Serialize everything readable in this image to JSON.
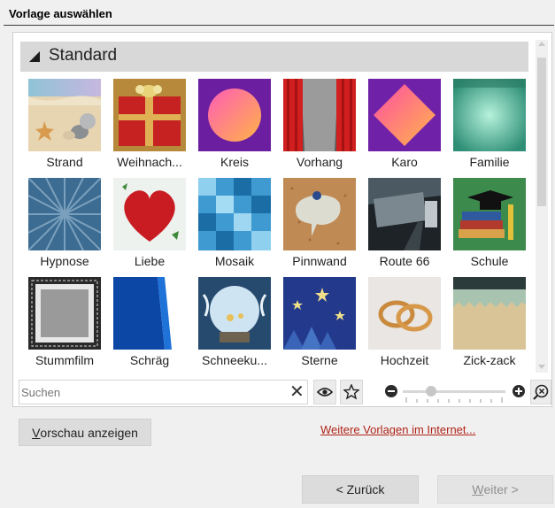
{
  "window": {
    "title": "Vorlage auswählen"
  },
  "group": {
    "title": "Standard"
  },
  "templates": [
    {
      "label": "Strand",
      "icon": "beach-thumbnail"
    },
    {
      "label": "Weihnach...",
      "icon": "gift-thumbnail"
    },
    {
      "label": "Kreis",
      "icon": "circle-thumbnail"
    },
    {
      "label": "Vorhang",
      "icon": "curtain-thumbnail"
    },
    {
      "label": "Karo",
      "icon": "diamond-thumbnail"
    },
    {
      "label": "Familie",
      "icon": "family-thumbnail"
    },
    {
      "label": "Hypnose",
      "icon": "hypnosis-thumbnail"
    },
    {
      "label": "Liebe",
      "icon": "heart-thumbnail"
    },
    {
      "label": "Mosaik",
      "icon": "mosaic-thumbnail"
    },
    {
      "label": "Pinnwand",
      "icon": "pinboard-thumbnail"
    },
    {
      "label": "Route 66",
      "icon": "road-thumbnail"
    },
    {
      "label": "Schule",
      "icon": "school-thumbnail"
    },
    {
      "label": "Stummfilm",
      "icon": "silent-film-thumbnail"
    },
    {
      "label": "Schräg",
      "icon": "diagonal-thumbnail"
    },
    {
      "label": "Schneeku...",
      "icon": "snow-globe-thumbnail"
    },
    {
      "label": "Sterne",
      "icon": "stars-thumbnail"
    },
    {
      "label": "Hochzeit",
      "icon": "wedding-rings-thumbnail"
    },
    {
      "label": "Zick-zack",
      "icon": "zigzag-thumbnail"
    }
  ],
  "search": {
    "placeholder": "Suchen",
    "value": ""
  },
  "toolbar": {
    "clear_icon": "clear-icon",
    "preview_icon": "eye-icon",
    "favorite_icon": "star-icon",
    "zoom_reset_icon": "zoom-reset-icon"
  },
  "buttons": {
    "preview_accel": "V",
    "preview_rest": "orschau anzeigen",
    "more_templates": "Weitere Vorlagen im Internet...",
    "back": "< Zurück",
    "next_accel": "W",
    "next_rest": "eiter >"
  },
  "colors": {
    "link": "#b02418",
    "header_bg": "#d8d8d8",
    "disabled_text": "#8f8f8f"
  }
}
